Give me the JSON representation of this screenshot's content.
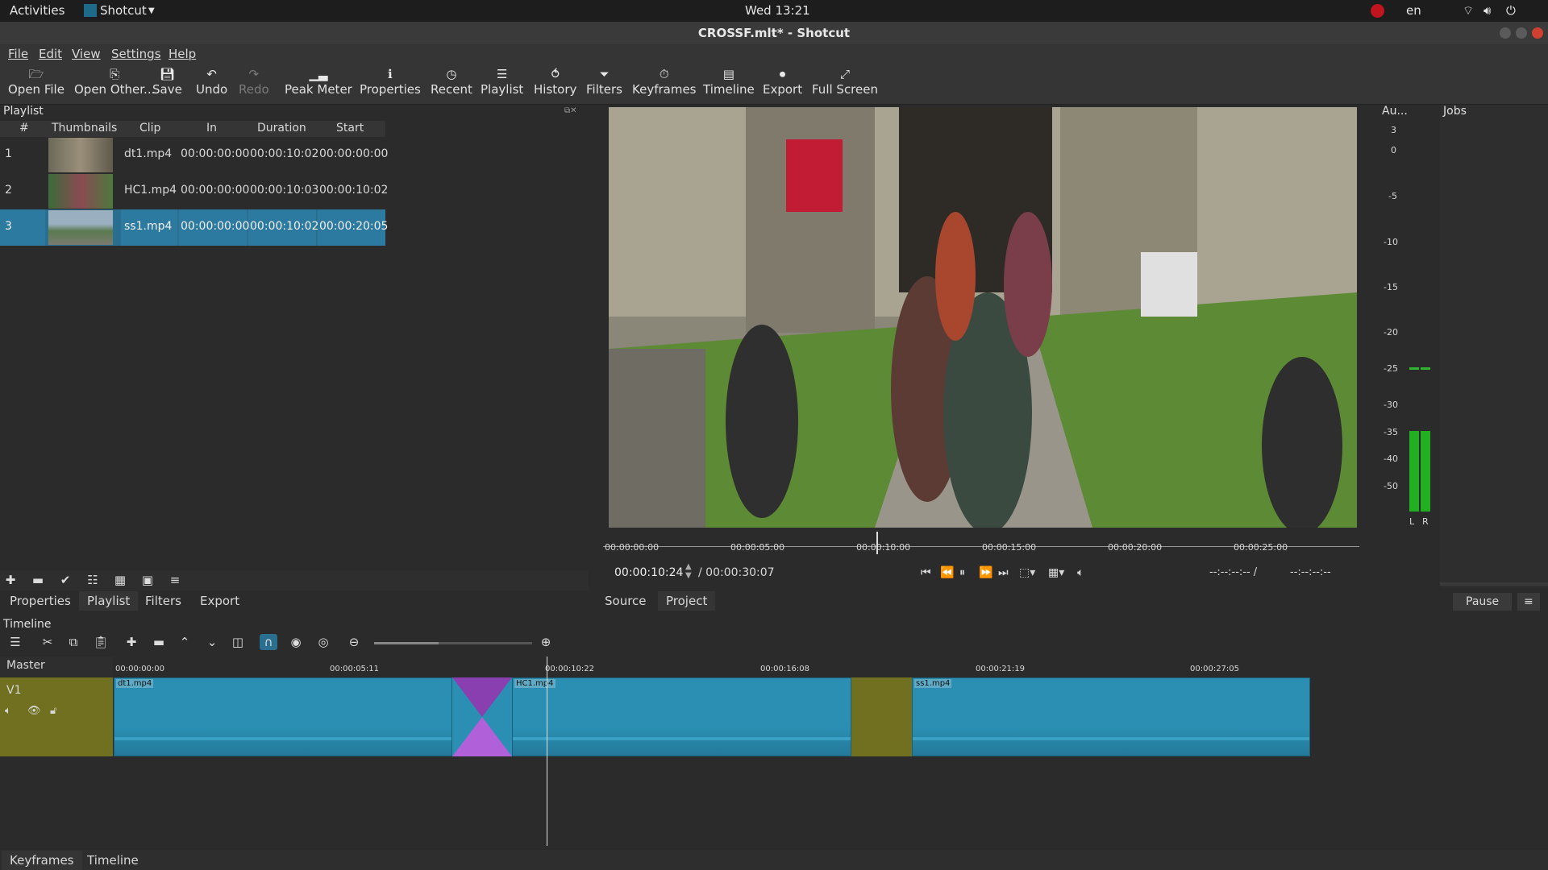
{
  "topbar": {
    "activities": "Activities",
    "app_name": "Shotcut",
    "clock": "Wed 13:21",
    "lang": "en"
  },
  "window": {
    "title": "CROSSF.mlt* - Shotcut"
  },
  "menu": {
    "items": [
      "File",
      "Edit",
      "View",
      "Settings",
      "Help"
    ]
  },
  "toolbar": {
    "items": [
      {
        "label": "Open File",
        "icon": "folder-icon"
      },
      {
        "label": "Open Other...",
        "icon": "open-other-icon"
      },
      {
        "label": "Save",
        "icon": "save-icon"
      },
      {
        "label": "Undo",
        "icon": "undo-icon"
      },
      {
        "label": "Redo",
        "icon": "redo-icon"
      },
      {
        "label": "Peak Meter",
        "icon": "peak-meter-icon"
      },
      {
        "label": "Properties",
        "icon": "info-icon"
      },
      {
        "label": "Recent",
        "icon": "clock-icon"
      },
      {
        "label": "Playlist",
        "icon": "list-icon"
      },
      {
        "label": "History",
        "icon": "history-icon"
      },
      {
        "label": "Filters",
        "icon": "funnel-icon"
      },
      {
        "label": "Keyframes",
        "icon": "stopwatch-icon"
      },
      {
        "label": "Timeline",
        "icon": "timeline-icon"
      },
      {
        "label": "Export",
        "icon": "export-icon"
      },
      {
        "label": "Full Screen",
        "icon": "fullscreen-icon"
      }
    ]
  },
  "playlist": {
    "title": "Playlist",
    "columns": [
      "#",
      "Thumbnails",
      "Clip",
      "In",
      "Duration",
      "Start"
    ],
    "rows": [
      {
        "num": "1",
        "clip": "dt1.mp4",
        "in": "00:00:00:00",
        "duration": "00:00:10:02",
        "start": "00:00:00:00"
      },
      {
        "num": "2",
        "clip": "HC1.mp4",
        "in": "00:00:00:00",
        "duration": "00:00:10:03",
        "start": "00:00:10:02"
      },
      {
        "num": "3",
        "clip": "ss1.mp4",
        "in": "00:00:00:00",
        "duration": "00:00:10:02",
        "start": "00:00:20:05"
      }
    ],
    "selected_row": 3
  },
  "left_tabs": [
    "Properties",
    "Playlist",
    "Filters",
    "Export"
  ],
  "player": {
    "ruler_ticks": [
      "00:00:00:00",
      "00:00:05:00",
      "00:00:10:00",
      "00:00:15:00",
      "00:00:20:00",
      "00:00:25:00"
    ],
    "current_time": "00:00:10:24",
    "total_time": "/ 00:00:30:07",
    "in_point": "--:--:--:-- /",
    "out_point": "--:--:--:--",
    "tabs": [
      "Source",
      "Project"
    ]
  },
  "audio_meter": {
    "title": "Au...",
    "scale": [
      "3",
      "0",
      "-5",
      "-10",
      "-15",
      "-20",
      "-25",
      "-30",
      "-35",
      "-40",
      "-50"
    ],
    "channels": [
      "L",
      "R"
    ]
  },
  "jobs": {
    "title": "Jobs",
    "pause_label": "Pause"
  },
  "timeline": {
    "title": "Timeline",
    "track_master": "Master",
    "track_v1": "V1",
    "ruler_ticks": [
      "00:00:00:00",
      "00:00:05:11",
      "00:00:10:22",
      "00:00:16:08",
      "00:00:21:19",
      "00:00:27:05"
    ],
    "clips": [
      {
        "label": "dt1.mp4"
      },
      {
        "label": "HC1.mp4"
      },
      {
        "label": "ss1.mp4"
      }
    ]
  },
  "bottom_tabs": [
    "Keyframes",
    "Timeline"
  ],
  "colors": {
    "selection": "#2a6f8f",
    "clip": "#2a8fb3",
    "track_header": "#707020",
    "transition": "#9a4fc0"
  }
}
